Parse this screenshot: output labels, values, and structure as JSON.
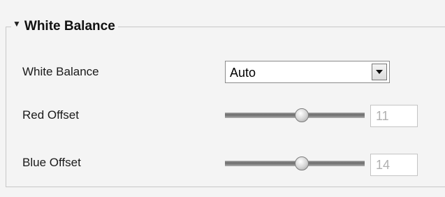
{
  "section": {
    "title": "White Balance"
  },
  "white_balance": {
    "label": "White Balance",
    "value": "Auto"
  },
  "red_offset": {
    "label": "Red Offset",
    "value": "11",
    "level": 0.55
  },
  "blue_offset": {
    "label": "Blue Offset",
    "value": "14",
    "level": 0.55
  },
  "icons": {
    "collapse": "triangle-down-icon",
    "dropdown": "chevron-down-icon"
  }
}
